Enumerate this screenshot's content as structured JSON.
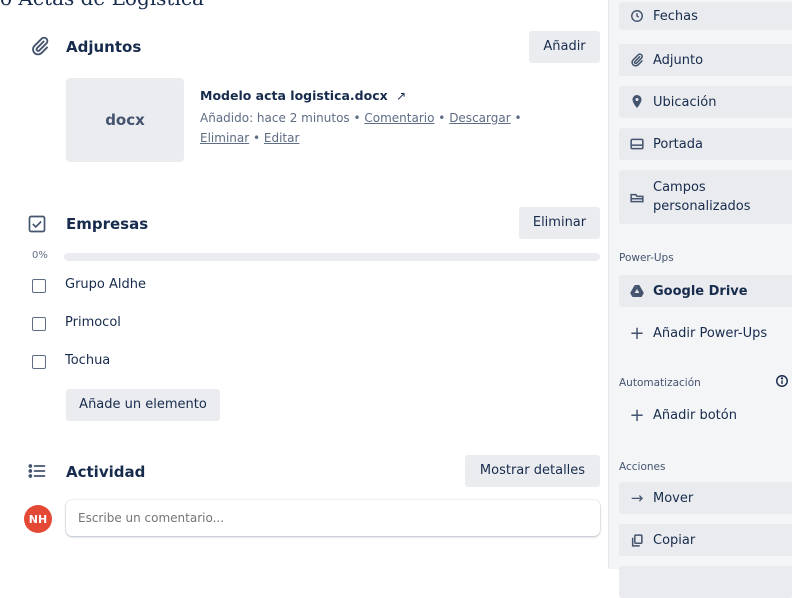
{
  "card": {
    "title_clipped": "o Actas de Logística"
  },
  "attachments": {
    "title": "Adjuntos",
    "add_label": "Añadir",
    "thumb_ext": "docx",
    "file_name": "Modelo acta logistica.docx",
    "added_text": "Añadido: hace 2 minutos",
    "sep": " • ",
    "comment_link": "Comentario",
    "download_link": "Descargar",
    "delete_link": "Eliminar",
    "edit_link": "Editar"
  },
  "checklist": {
    "title": "Empresas",
    "delete_label": "Eliminar",
    "progress_text": "0%",
    "progress": 0,
    "items": [
      {
        "label": "Grupo Aldhe",
        "checked": false
      },
      {
        "label": "Primocol",
        "checked": false
      },
      {
        "label": "Tochua",
        "checked": false
      }
    ],
    "add_item_label": "Añade un elemento"
  },
  "activity": {
    "title": "Actividad",
    "show_details_label": "Mostrar detalles",
    "avatar_initials": "NH",
    "comment_placeholder": "Escribe un comentario..."
  },
  "sidebar": {
    "buttons": [
      {
        "label": "Fechas",
        "icon": "clock-icon"
      },
      {
        "label": "Adjunto",
        "icon": "paperclip-icon"
      },
      {
        "label": "Ubicación",
        "icon": "location-pin-icon"
      },
      {
        "label": "Portada",
        "icon": "cover-icon"
      },
      {
        "label": "Campos personalizados",
        "icon": "custom-fields-icon"
      }
    ],
    "powerups_heading": "Power-Ups",
    "google_drive_label": "Google Drive",
    "add_powerups_label": "Añadir Power-Ups",
    "automation_heading": "Automatización",
    "add_button_label": "Añadir botón",
    "actions_heading": "Acciones",
    "move_label": "Mover",
    "copy_label": "Copiar"
  },
  "colors": {
    "accent": "#5ba4cf",
    "avatar_bg": "#e34935",
    "button_bg": "#ebecf0"
  }
}
